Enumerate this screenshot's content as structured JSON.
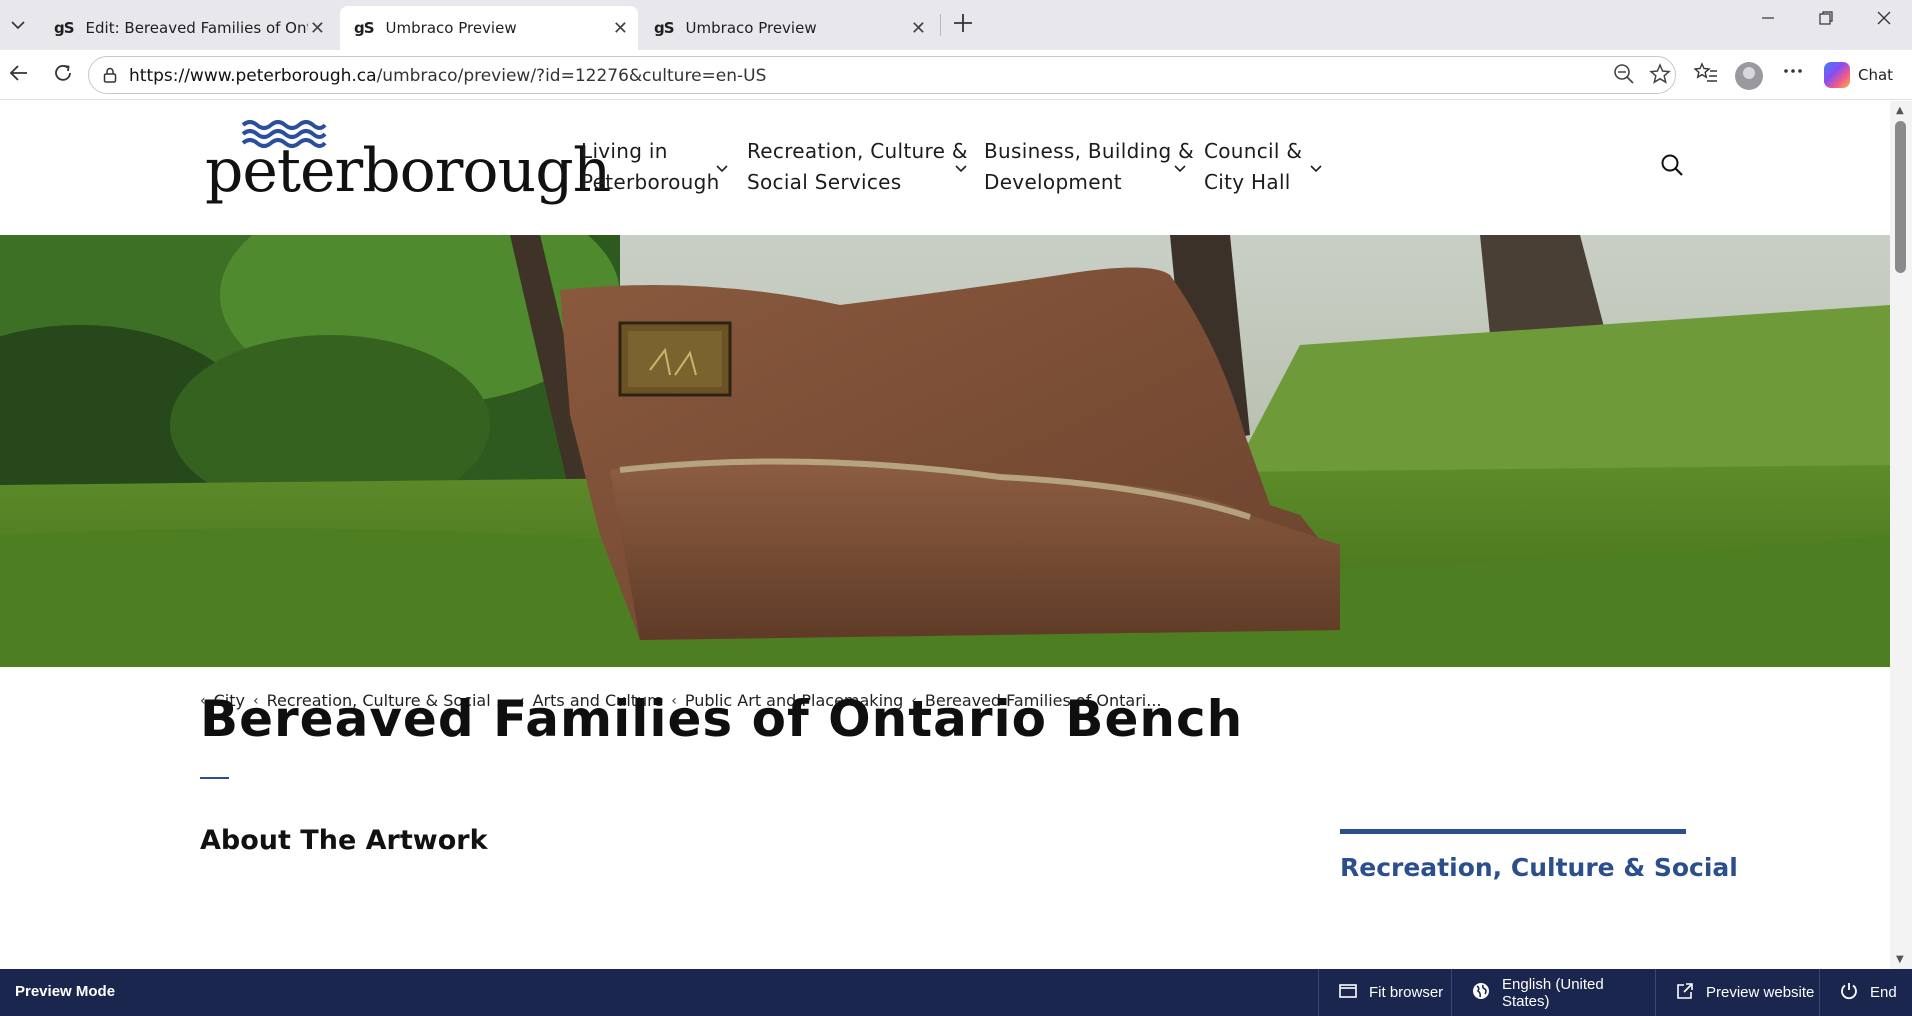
{
  "browser": {
    "tabs": [
      {
        "favicon": "gS",
        "title": "Edit: Bereaved Families of Ontario",
        "active": false
      },
      {
        "favicon": "gS",
        "title": "Umbraco Preview",
        "active": true
      },
      {
        "favicon": "gS",
        "title": "Umbraco Preview",
        "active": false
      }
    ],
    "url_host": "https://www.peterborough.ca",
    "url_path": "/umbraco/preview/?id=12276&culture=en-US",
    "chat_label": "Chat",
    "icons": [
      "tab-list-chevron-icon",
      "close-icon",
      "new-tab-plus-icon",
      "minimize-icon",
      "restore-icon",
      "window-close-icon",
      "back-arrow-icon",
      "refresh-icon",
      "lock-icon",
      "zoom-out-icon",
      "favorite-star-icon",
      "favorites-list-icon",
      "profile-avatar-icon",
      "more-dots-icon",
      "copilot-icon"
    ]
  },
  "site": {
    "logo_text": "peterborough",
    "nav": [
      {
        "line1": "Living in",
        "line2": "Peterborough"
      },
      {
        "line1": "Recreation, Culture &",
        "line2": "Social Services"
      },
      {
        "line1": "Business, Building &",
        "line2": "Development"
      },
      {
        "line1": "Council &",
        "line2": "City Hall"
      }
    ],
    "breadcrumb": [
      "City",
      "Recreation, Culture & Social ...",
      "Arts and Culture",
      "Public Art and Placemaking",
      "Bereaved Families of Ontari..."
    ],
    "page_title": "Bereaved Families of Ontario Bench",
    "section_heading": "About The Artwork",
    "sidebar_title": "Recreation, Culture & Social"
  },
  "preview_bar": {
    "label": "Preview Mode",
    "fit_browser": "Fit browser",
    "language": "English (United States)",
    "preview_website": "Preview website",
    "end": "End"
  },
  "colors": {
    "navy": "#1b264f",
    "accent_blue": "#2b4f8c",
    "tab_strip": "#e8e8ec"
  }
}
